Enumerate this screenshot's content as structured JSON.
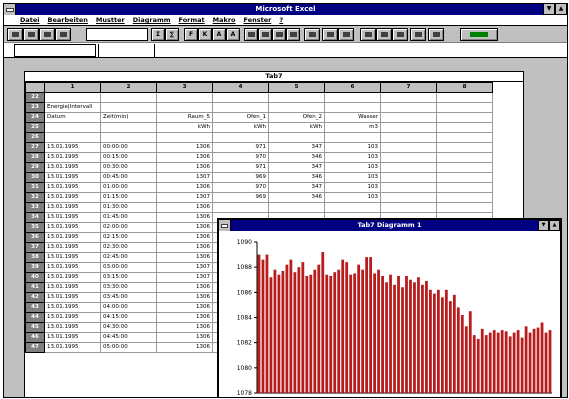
{
  "app": {
    "title": "Microsoft Excel",
    "menu": [
      "Datei",
      "Bearbeiten",
      "Mustter",
      "Diagramm",
      "Format",
      "Makro",
      "Fenster",
      "?"
    ]
  },
  "sheet": {
    "title": "Tab7",
    "columns": [
      "1",
      "2",
      "3",
      "4",
      "5",
      "6",
      "7",
      "8"
    ],
    "rows": [
      {
        "num": "22",
        "cells": [
          "",
          "",
          "",
          "",
          "",
          "",
          "",
          ""
        ]
      },
      {
        "num": "23",
        "cells": [
          "Energie|Intervall",
          "",
          "",
          "",
          "",
          "",
          "",
          ""
        ]
      },
      {
        "num": "24",
        "cells": [
          "Datum",
          "Zeit(min)",
          "Raum_5",
          "Ofen_1",
          "Ofen_2",
          "Wasser",
          "",
          ""
        ]
      },
      {
        "num": "25",
        "cells": [
          "",
          "",
          "kWh",
          "kWh",
          "kWh",
          "m3",
          "",
          ""
        ]
      },
      {
        "num": "26",
        "cells": [
          "",
          "",
          "",
          "",
          "",
          "",
          "",
          ""
        ]
      },
      {
        "num": "27",
        "cells": [
          "13.01.1995",
          "00:00:00",
          "1306",
          "971",
          "347",
          "103",
          "",
          ""
        ]
      },
      {
        "num": "28",
        "cells": [
          "13.01.1995",
          "00:15:00",
          "1306",
          "970",
          "346",
          "103",
          "",
          ""
        ]
      },
      {
        "num": "29",
        "cells": [
          "13.01.1995",
          "00:30:00",
          "1306",
          "971",
          "347",
          "103",
          "",
          ""
        ]
      },
      {
        "num": "30",
        "cells": [
          "13.01.1995",
          "00:45:00",
          "1307",
          "969",
          "346",
          "103",
          "",
          ""
        ]
      },
      {
        "num": "31",
        "cells": [
          "13.01.1995",
          "01:00:00",
          "1306",
          "970",
          "347",
          "103",
          "",
          ""
        ]
      },
      {
        "num": "32",
        "cells": [
          "13.01.1995",
          "01:15:00",
          "1307",
          "969",
          "346",
          "103",
          "",
          ""
        ]
      },
      {
        "num": "33",
        "cells": [
          "13.01.1995",
          "01:30:00",
          "1306",
          "",
          "",
          "",
          "",
          ""
        ]
      },
      {
        "num": "34",
        "cells": [
          "13.01.1995",
          "01:45:00",
          "1306",
          "",
          "",
          "",
          "",
          ""
        ]
      },
      {
        "num": "35",
        "cells": [
          "13.01.1995",
          "02:00:00",
          "1306",
          "",
          "",
          "",
          "",
          ""
        ]
      },
      {
        "num": "36",
        "cells": [
          "13.01.1995",
          "02:15:00",
          "1306",
          "",
          "",
          "",
          "",
          ""
        ]
      },
      {
        "num": "37",
        "cells": [
          "13.01.1995",
          "02:30:00",
          "1306",
          "",
          "",
          "",
          "",
          ""
        ]
      },
      {
        "num": "38",
        "cells": [
          "13.01.1995",
          "02:45:00",
          "1306",
          "",
          "",
          "",
          "",
          ""
        ]
      },
      {
        "num": "39",
        "cells": [
          "13.01.1995",
          "03:00:00",
          "1307",
          "",
          "",
          "",
          "",
          ""
        ]
      },
      {
        "num": "40",
        "cells": [
          "13.01.1995",
          "03:15:00",
          "1307",
          "",
          "",
          "",
          "",
          ""
        ]
      },
      {
        "num": "41",
        "cells": [
          "13.01.1995",
          "03:30:00",
          "1306",
          "",
          "",
          "",
          "",
          ""
        ]
      },
      {
        "num": "42",
        "cells": [
          "13.01.1995",
          "03:45:00",
          "1306",
          "",
          "",
          "",
          "",
          ""
        ]
      },
      {
        "num": "43",
        "cells": [
          "13.01.1995",
          "04:00:00",
          "1306",
          "",
          "",
          "",
          "",
          ""
        ]
      },
      {
        "num": "44",
        "cells": [
          "13.01.1995",
          "04:15:00",
          "1306",
          "",
          "",
          "",
          "",
          ""
        ]
      },
      {
        "num": "45",
        "cells": [
          "13.01.1995",
          "04:30:00",
          "1306",
          "",
          "",
          "",
          "",
          ""
        ]
      },
      {
        "num": "46",
        "cells": [
          "13.01.1995",
          "04:45:00",
          "1306",
          "",
          "",
          "",
          "",
          ""
        ]
      },
      {
        "num": "47",
        "cells": [
          "13.01.1995",
          "05:00:00",
          "1306",
          "",
          "",
          "",
          "",
          ""
        ]
      }
    ]
  },
  "chart_window": {
    "title": "Tab7 Diagramm 1"
  },
  "chart_data": {
    "type": "bar",
    "ylim": [
      1078,
      1090
    ],
    "yticks": [
      "1090",
      "1088",
      "1086",
      "1084",
      "1082",
      "1080",
      "1078"
    ],
    "values": [
      1089,
      1088.6,
      1089,
      1087.2,
      1087.8,
      1087.4,
      1087.7,
      1088.2,
      1088.6,
      1087.6,
      1088,
      1088.4,
      1087.3,
      1087.4,
      1087.8,
      1088.2,
      1089.2,
      1087.4,
      1087.3,
      1087.6,
      1087.8,
      1088.6,
      1088.4,
      1087.4,
      1087.5,
      1088.2,
      1087.8,
      1088.8,
      1088.8,
      1087.5,
      1087.8,
      1087.3,
      1086.8,
      1087.4,
      1086.6,
      1087.3,
      1086.4,
      1087.3,
      1087,
      1086.8,
      1087.2,
      1086.6,
      1086.9,
      1086.2,
      1085.9,
      1086.2,
      1085.6,
      1086.2,
      1085.3,
      1085.8,
      1084.8,
      1084.2,
      1083.3,
      1084.5,
      1082.6,
      1082.3,
      1083.1,
      1082.6,
      1082.8,
      1083,
      1082.8,
      1083,
      1082.9,
      1082.5,
      1082.8,
      1083,
      1082.4,
      1083.3,
      1082.8,
      1083.1,
      1083.2,
      1083.6,
      1082.8,
      1083
    ],
    "bar_color": "#b81c1c"
  }
}
